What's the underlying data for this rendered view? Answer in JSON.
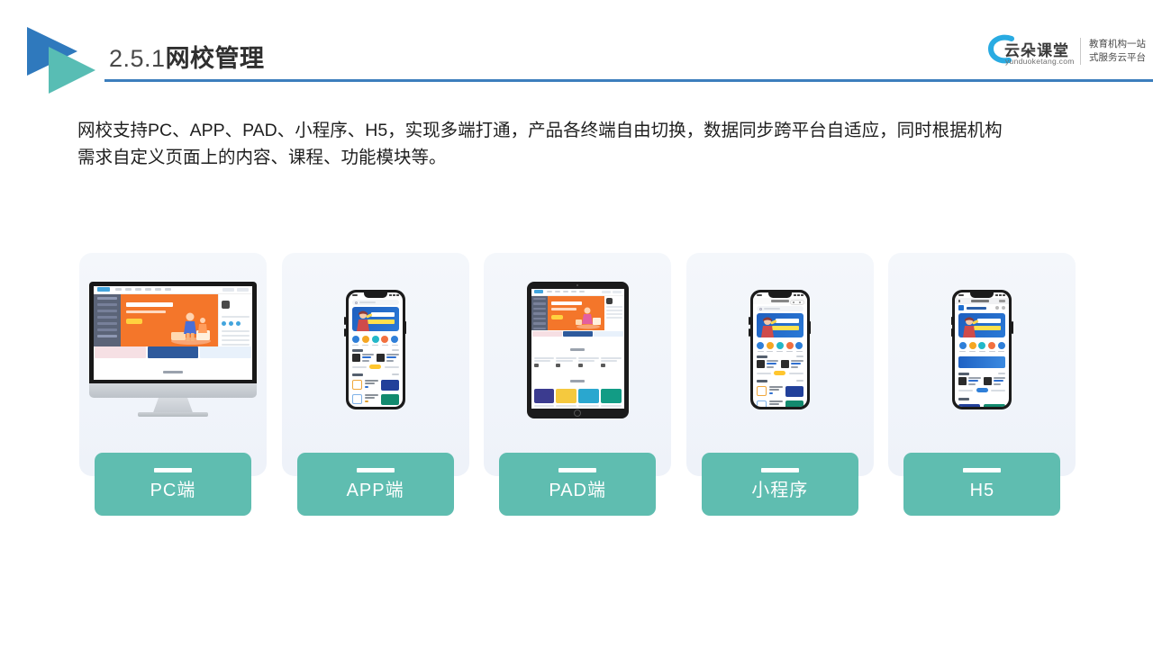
{
  "header": {
    "title_number": "2.5.1",
    "title_text": "网校管理",
    "logo_icon": "double-triangle-play-logo",
    "rule_color": "#3c7ebd"
  },
  "brand": {
    "cloud_icon": "cloud-icon",
    "name": "云朵课堂",
    "url": "yunduoketang.com",
    "tagline_line1": "教育机构一站",
    "tagline_line2": "式服务云平台",
    "accent_color": "#29abe2"
  },
  "body": {
    "paragraph_line1": "网校支持PC、APP、PAD、小程序、H5，实现多端打通，产品各终端自由切换，数据同步跨平台自适应，同时根据机构",
    "paragraph_line2": "需求自定义页面上的内容、课程、功能模块等。"
  },
  "cards": [
    {
      "label": "PC端",
      "device": "desktop-monitor",
      "icon": "monitor-icon"
    },
    {
      "label": "APP端",
      "device": "smartphone",
      "icon": "phone-icon"
    },
    {
      "label": "PAD端",
      "device": "tablet",
      "icon": "tablet-icon"
    },
    {
      "label": "小程序",
      "device": "smartphone-miniprogram",
      "icon": "phone-icon"
    },
    {
      "label": "H5",
      "device": "smartphone-browser",
      "icon": "phone-icon"
    }
  ],
  "colors": {
    "label_teal": "#5fbdb0",
    "card_bg": "#f2f5fa",
    "hero_orange": "#f4762a",
    "banner_blue": "#2a79d6"
  }
}
